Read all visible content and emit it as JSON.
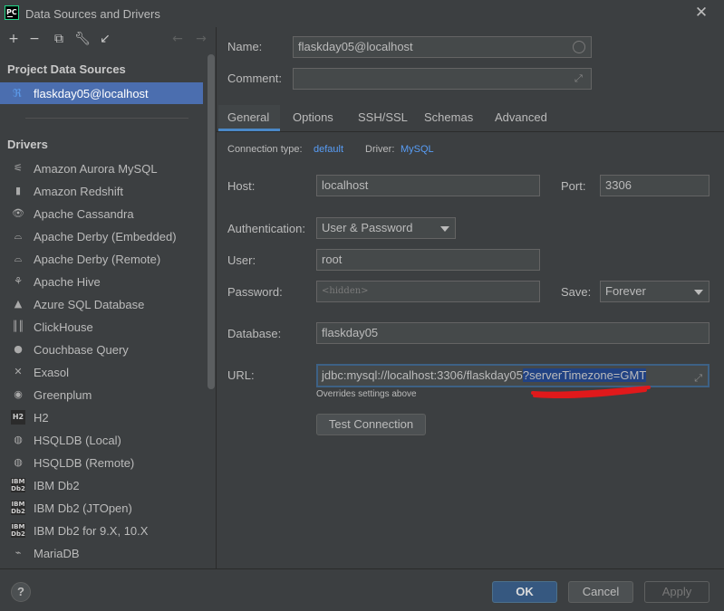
{
  "window": {
    "app_icon": "PC",
    "title": "Data Sources and Drivers",
    "close_icon": "close-icon"
  },
  "toolbar": {
    "icons": [
      "add-icon",
      "remove-icon",
      "duplicate-icon",
      "settings-wrench-icon",
      "import-icon",
      "back-arrow-icon",
      "forward-arrow-icon"
    ]
  },
  "sidebar": {
    "project_title": "Project Data Sources",
    "data_source": "flaskday05@localhost",
    "drivers_title": "Drivers",
    "drivers": [
      {
        "label": "Amazon Aurora MySQL",
        "icon": "aurora-icon"
      },
      {
        "label": "Amazon Redshift",
        "icon": "redshift-icon"
      },
      {
        "label": "Apache Cassandra",
        "icon": "cassandra-icon"
      },
      {
        "label": "Apache Derby (Embedded)",
        "icon": "derby-icon"
      },
      {
        "label": "Apache Derby (Remote)",
        "icon": "derby-icon"
      },
      {
        "label": "Apache Hive",
        "icon": "hive-icon"
      },
      {
        "label": "Azure SQL Database",
        "icon": "azure-icon"
      },
      {
        "label": "ClickHouse",
        "icon": "clickhouse-icon"
      },
      {
        "label": "Couchbase Query",
        "icon": "couchbase-icon"
      },
      {
        "label": "Exasol",
        "icon": "exasol-icon"
      },
      {
        "label": "Greenplum",
        "icon": "greenplum-icon"
      },
      {
        "label": "H2",
        "icon": "h2-icon"
      },
      {
        "label": "HSQLDB (Local)",
        "icon": "hsqldb-icon"
      },
      {
        "label": "HSQLDB (Remote)",
        "icon": "hsqldb-icon"
      },
      {
        "label": "IBM Db2",
        "icon": "db2-icon"
      },
      {
        "label": "IBM Db2 (JTOpen)",
        "icon": "db2-icon"
      },
      {
        "label": "IBM Db2 for 9.X, 10.X",
        "icon": "db2-icon"
      },
      {
        "label": "MariaDB",
        "icon": "mariadb-icon"
      }
    ]
  },
  "form": {
    "name_label": "Name:",
    "name_value": "flaskday05@localhost",
    "comment_label": "Comment:",
    "comment_value": "",
    "tabs": [
      "General",
      "Options",
      "SSH/SSL",
      "Schemas",
      "Advanced"
    ],
    "active_tab": "General",
    "connection_type_label": "Connection type:",
    "connection_type_value": "default",
    "driver_label": "Driver:",
    "driver_value": "MySQL",
    "host_label": "Host:",
    "host_value": "localhost",
    "port_label": "Port:",
    "port_value": "3306",
    "auth_label": "Authentication:",
    "auth_value": "User & Password",
    "user_label": "User:",
    "user_value": "root",
    "password_label": "Password:",
    "password_placeholder": "<hidden>",
    "save_label": "Save:",
    "save_value": "Forever",
    "database_label": "Database:",
    "database_value": "flaskday05",
    "url_label": "URL:",
    "url_value_plain": "jdbc:mysql://localhost:3306/flaskday05",
    "url_value_selected": "?serverTimezone=GMT",
    "url_hint": "Overrides settings above",
    "test_connection": "Test Connection"
  },
  "footer": {
    "help": "?",
    "ok": "OK",
    "cancel": "Cancel",
    "apply": "Apply"
  },
  "colors": {
    "background": "#3c3f41",
    "selection": "#4b6eaf",
    "link": "#589df6",
    "annotation": "#e0191b"
  }
}
